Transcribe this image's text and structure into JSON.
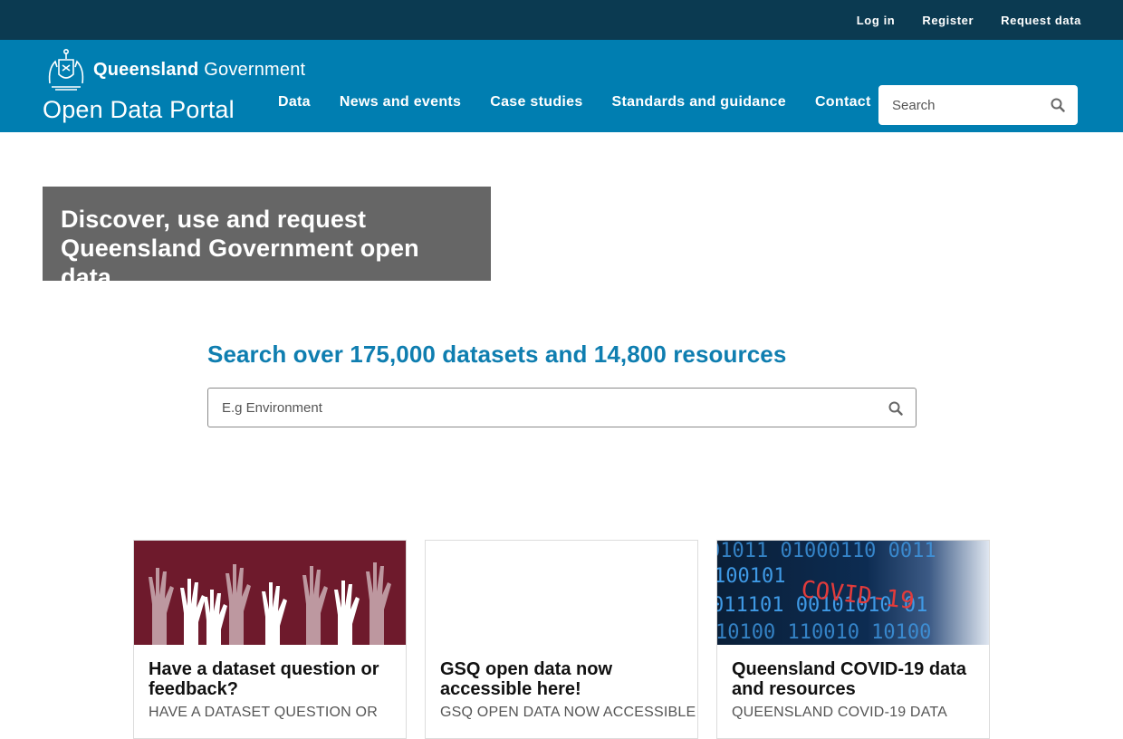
{
  "topbar": {
    "links": [
      "Log in",
      "Register",
      "Request data"
    ]
  },
  "header": {
    "gov_name_bold": "Queensland",
    "gov_name_light": "Government",
    "portal_title": "Open Data Portal",
    "nav": [
      "Data",
      "News and events",
      "Case studies",
      "Standards and guidance",
      "Contact"
    ],
    "search_placeholder": "Search"
  },
  "hero": {
    "line1": "Discover, use and request",
    "line2": "Queensland Government open data"
  },
  "search": {
    "heading": "Search over 175,000 datasets and 14,800 resources",
    "placeholder": "E.g Environment"
  },
  "cards": [
    {
      "title": "Have a dataset question or feedback?",
      "excerpt": "HAVE A DATASET QUESTION OR"
    },
    {
      "title": "GSQ open data now accessible here!",
      "excerpt": "GSQ OPEN DATA NOW ACCESSIBLE"
    },
    {
      "title": "Queensland COVID-19 data and resources",
      "excerpt": "QUEENSLAND COVID-19 DATA",
      "image_text": "COVID-19"
    }
  ],
  "colors": {
    "topbar": "#0b3a51",
    "header": "#007eb1",
    "hero": "#666666",
    "heading": "#0f7eb0",
    "card1": "#6e1a2c"
  }
}
